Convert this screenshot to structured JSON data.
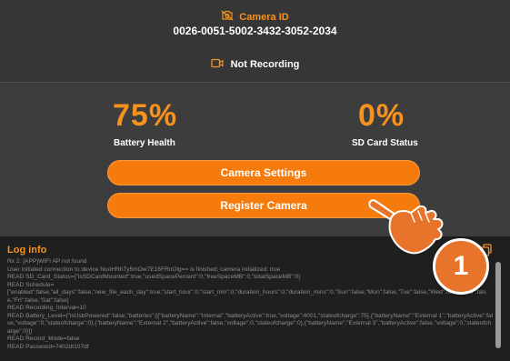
{
  "header": {
    "camera_id_label": "Camera ID",
    "camera_id_value": "0026-0051-5002-3432-3052-2034",
    "recording_status": "Not Recording"
  },
  "stats": {
    "battery_percent": "75%",
    "battery_label": "Battery Health",
    "sd_percent": "0%",
    "sd_label": "SD Card Status"
  },
  "buttons": {
    "settings": "Camera Settings",
    "register": "Register Camera"
  },
  "log": {
    "title": "Log info",
    "lines": [
      "Rx 2: [APP]WIFI AP not found",
      "User initiated connection to device NuoHRhTy5mOw7E16FRnOlg== is finished; camera initialized: true",
      "READ SD_Card_Status={\"isSDCardMounted\":true,\"usedSpacePercent\":0,\"freeSpaceMB\":0,\"totalSpaceMB\":0}",
      "READ Schedule=",
      "[\"enabled\":false,\"all_days\":false,\"new_file_each_day\":true,\"start_hour\":0,\"start_min\":0,\"duration_hours\":0,\"duration_mins\":0,\"Sun\":false,\"Mon\":false,\"Tue\":false,\"Wed\":false,\"Thu\":false,\"Fri\":false,\"Sat\":false]",
      "READ Recording_Interval=10",
      "READ Battery_Level={\"isUsbPowered\":false,\"batteries\":[{\"batteryName\":\"Internal\",\"batteryActive\":true,\"voltage\":4001,\"stateofcharge\":75},{\"batteryName\":\"External 1\",\"batteryActive\":false,\"voltage\":0,\"stateofcharge\":0},{\"batteryName\":\"External 2\",\"batteryActive\":false,\"voltage\":0,\"stateofcharge\":0},{\"batteryName\":\"External 3\",\"batteryActive\":false,\"voltage\":0,\"stateofcharge\":0}]}",
      "READ Record_Mode=false",
      "READ Password=7402dt107df"
    ]
  },
  "annotation": {
    "step_number": "1"
  },
  "colors": {
    "accent": "#f7921e",
    "button": "#f57c0c",
    "background": "#3d3d3d",
    "log_background": "#1f1f1f"
  },
  "icons": [
    "camera-off-icon",
    "video-camera-icon",
    "copy-icon",
    "pointing-hand-icon"
  ]
}
